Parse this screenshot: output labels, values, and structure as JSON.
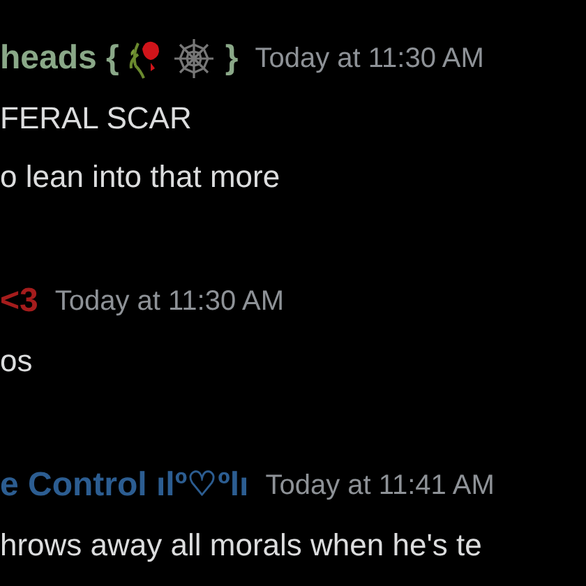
{
  "messages": [
    {
      "author": "heads {",
      "author_suffix": "}",
      "emoji": [
        {
          "kind": "wilted-rose"
        },
        {
          "kind": "spider-web"
        }
      ],
      "color": "#8aa888",
      "timestamp": "Today at 11:30 AM",
      "lines": [
        "FERAL SCAR",
        "o lean into that more"
      ]
    },
    {
      "author": "<3",
      "color": "#a51c1c",
      "timestamp": "Today at 11:30 AM",
      "lines": [
        "os"
      ]
    },
    {
      "author": "e Control ılº♡ºlı",
      "color": "#2c5d91",
      "timestamp": "Today at 11:41 AM",
      "lines": [
        "hrows away all morals when he's te"
      ]
    }
  ]
}
